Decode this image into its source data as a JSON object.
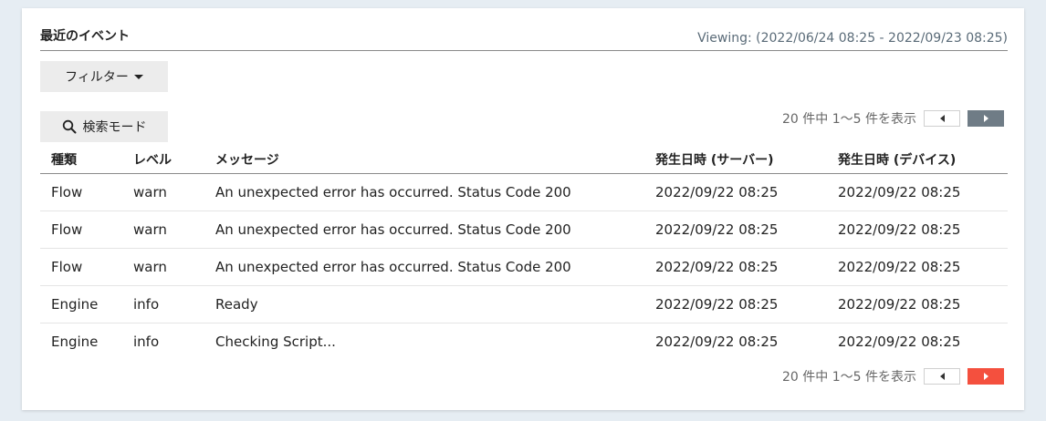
{
  "panel": {
    "title": "最近のイベント",
    "viewing": "Viewing: (2022/06/24 08:25 - 2022/09/23 08:25)"
  },
  "toolbar": {
    "filter_label": "フィルター",
    "search_label": "検索モード"
  },
  "pager": {
    "text": "20 件中 1〜5 件を表示"
  },
  "table": {
    "headers": [
      "種類",
      "レベル",
      "メッセージ",
      "発生日時 (サーバー)",
      "発生日時 (デバイス)"
    ],
    "rows": [
      [
        "Flow",
        "warn",
        "An unexpected error has occurred. Status Code 200",
        "2022/09/22 08:25",
        "2022/09/22 08:25"
      ],
      [
        "Flow",
        "warn",
        "An unexpected error has occurred. Status Code 200",
        "2022/09/22 08:25",
        "2022/09/22 08:25"
      ],
      [
        "Flow",
        "warn",
        "An unexpected error has occurred. Status Code 200",
        "2022/09/22 08:25",
        "2022/09/22 08:25"
      ],
      [
        "Engine",
        "info",
        "Ready",
        "2022/09/22 08:25",
        "2022/09/22 08:25"
      ],
      [
        "Engine",
        "info",
        "Checking Script...",
        "2022/09/22 08:25",
        "2022/09/22 08:25"
      ]
    ]
  },
  "colors": {
    "next_active": "#f4503e",
    "next_dark": "#6f7c86"
  }
}
